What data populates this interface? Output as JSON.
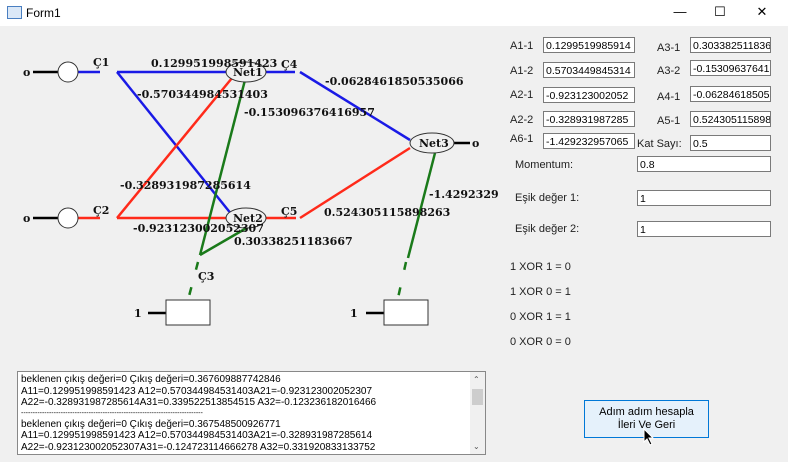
{
  "window": {
    "title": "Form1",
    "minimize": "—",
    "maximize": "☐",
    "close": "✕"
  },
  "diagram": {
    "in1": "o",
    "in2": "o",
    "out": "o",
    "bias1": "1",
    "bias2": "1",
    "c1": "Ç1",
    "c2": "Ç2",
    "c3": "Ç3",
    "c4": "Ç4",
    "c5": "Ç5",
    "net1": "Net1",
    "net2": "Net2",
    "net3": "Net3",
    "w11": "0.129951998591423",
    "w12": "-0.570344984531403",
    "w21": "-0.328931987285614",
    "w22": "-0.923123002052307",
    "w31": "0.30338251183667",
    "w32": "-0.153096376416957",
    "w41": "-0.0628461850535066",
    "w51": "0.524305115898263",
    "w61": "-1.4292329"
  },
  "weights": [
    {
      "label": "A1-1",
      "value": "0.1299519985914"
    },
    {
      "label": "A1-2",
      "value": "0.5703449845314"
    },
    {
      "label": "A2-1",
      "value": "-0.923123002052"
    },
    {
      "label": "A2-2",
      "value": "-0.328931987285"
    },
    {
      "label": "A6-1",
      "value": "-1.429232957065"
    },
    {
      "label": "A3-1",
      "value": "0.3033825118366"
    },
    {
      "label": "A3-2",
      "value": "-0.153096376416"
    },
    {
      "label": "A4-1",
      "value": "-0.062846185053"
    },
    {
      "label": "A5-1",
      "value": "0.5243051158982"
    }
  ],
  "kat_sayi": {
    "label": "Kat Sayı:",
    "value": "0.5"
  },
  "momentum": {
    "label": "Momentum:",
    "value": "0.8"
  },
  "esik1": {
    "label": "Eşik değer 1:",
    "value": "1"
  },
  "esik2": {
    "label": "Eşik değer 2:",
    "value": "1"
  },
  "xor": [
    "1 XOR 1 = 0",
    "1 XOR 0 = 1",
    "0 XOR 1 = 1",
    "0 XOR 0 = 0"
  ],
  "log": [
    "beklenen çıkış değeri=0 Çıkış değeri=0.367609887742846",
    "A11=0.129951998591423 A12=0.570344984531403A21=-0.923123002052307",
    "A22=-0.328931987285614A31=0.339522513854515 A32=-0.123236182016466",
    "------------------------------------------------------------------------------",
    "beklenen çıkış değeri=0 Çıkış değeri=0.367548500926771",
    "A11=0.129951998591423 A12=0.570344984531403A21=-0.328931987285614",
    "A22=-0.923123002052307A31=-0.124723114666278 A32=0.331920833133752"
  ],
  "button": {
    "line1": "Adım adım hesapla",
    "line2": "İleri Ve Geri"
  }
}
